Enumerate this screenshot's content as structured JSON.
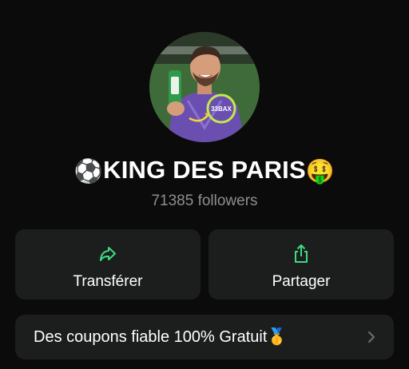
{
  "profile": {
    "name": "KING DES PARIS",
    "name_prefix_emoji": "⚽",
    "name_suffix_emoji": "🤑",
    "followers": "71385 followers",
    "avatar_caption": "33BAX"
  },
  "actions": [
    {
      "label": "Transférer",
      "icon": "share-arrow-icon"
    },
    {
      "label": "Partager",
      "icon": "share-upload-icon"
    }
  ],
  "description": {
    "text": "Des coupons fiable 100% Gratuit",
    "emoji": "🥇",
    "icon": "chevron-right-icon"
  },
  "colors": {
    "background": "#0b0b0b",
    "card": "#1c1d1d",
    "accent": "#3ddc84",
    "muted_text": "#8e8e8e"
  }
}
